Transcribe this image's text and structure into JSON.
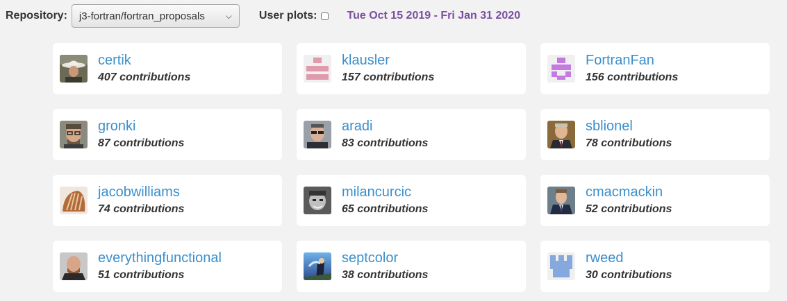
{
  "toolbar": {
    "repository_label": "Repository:",
    "repository_value": "j3-fortran/fortran_proposals",
    "user_plots_label": "User plots:",
    "date_range": "Tue Oct 15 2019 - Fri Jan 31 2020"
  },
  "contributors": [
    {
      "name": "certik",
      "contributions": "407 contributions",
      "avatar": "photo-cowboy-hat"
    },
    {
      "name": "klausler",
      "contributions": "157 contributions",
      "avatar": "identicon-pink"
    },
    {
      "name": "FortranFan",
      "contributions": "156 contributions",
      "avatar": "identicon-purple"
    },
    {
      "name": "gronki",
      "contributions": "87 contributions",
      "avatar": "photo-glasses"
    },
    {
      "name": "aradi",
      "contributions": "83 contributions",
      "avatar": "photo-glasses-dark"
    },
    {
      "name": "sblionel",
      "contributions": "78 contributions",
      "avatar": "photo-suit"
    },
    {
      "name": "jacobwilliams",
      "contributions": "74 contributions",
      "avatar": "photo-shell"
    },
    {
      "name": "milancurcic",
      "contributions": "65 contributions",
      "avatar": "photo-grayscale"
    },
    {
      "name": "cmacmackin",
      "contributions": "52 contributions",
      "avatar": "photo-tie"
    },
    {
      "name": "everythingfunctional",
      "contributions": "51 contributions",
      "avatar": "photo-bald"
    },
    {
      "name": "septcolor",
      "contributions": "38 contributions",
      "avatar": "photo-blue-art"
    },
    {
      "name": "rweed",
      "contributions": "30 contributions",
      "avatar": "identicon-blue"
    }
  ]
}
